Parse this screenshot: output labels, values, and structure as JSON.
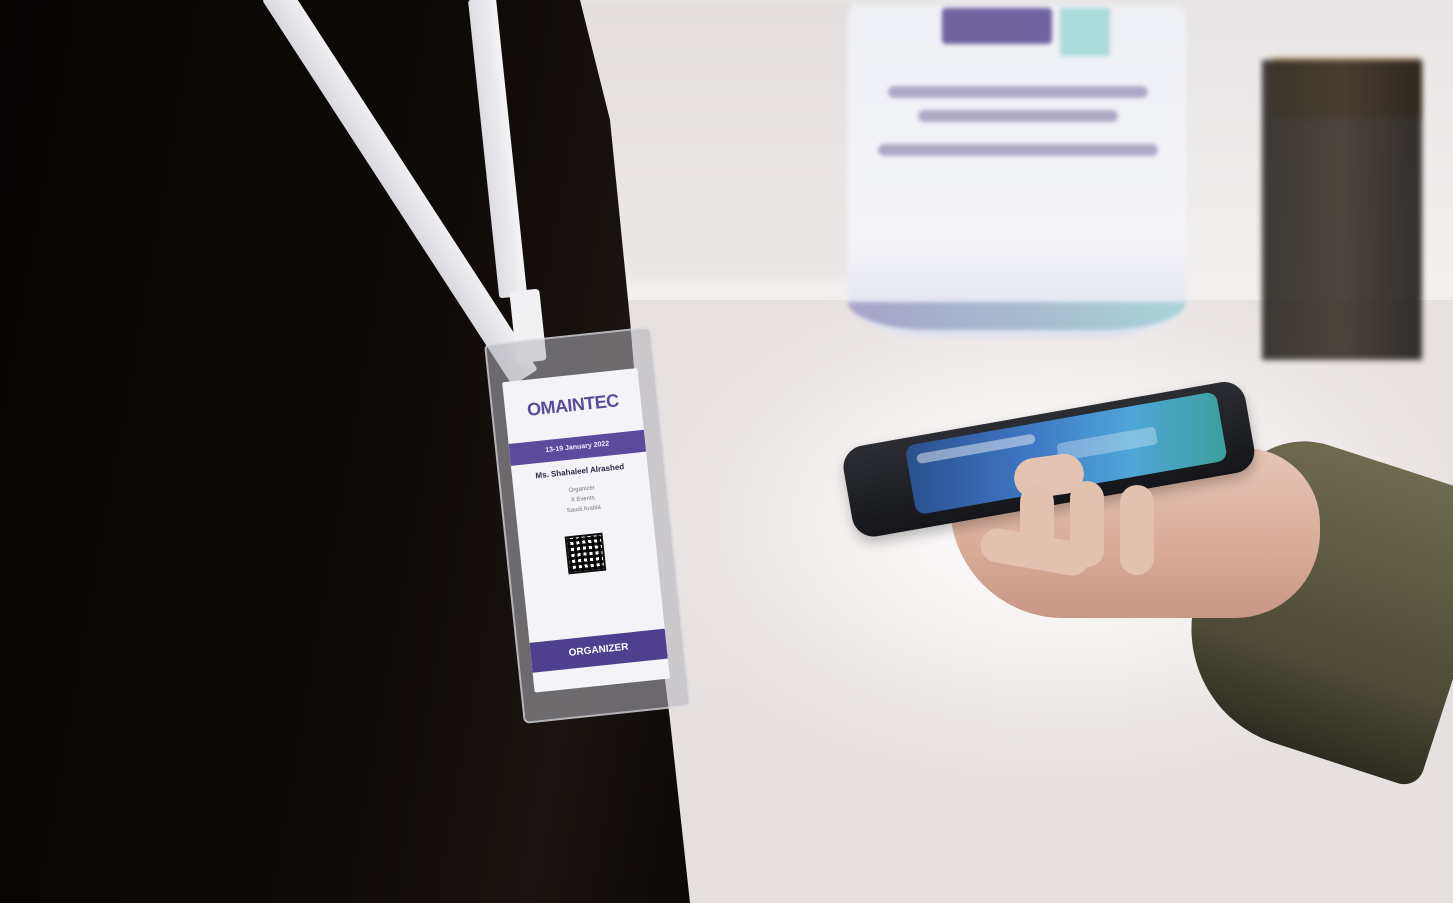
{
  "badge": {
    "logo_text": "OMAINTEC",
    "date_text": "13-19 January 2022",
    "name": "Ms. Shahaleel Alrashed",
    "line1": "Organizer",
    "line2": "X Events",
    "line3": "Saudi Arabia",
    "role": "ORGANIZER"
  }
}
